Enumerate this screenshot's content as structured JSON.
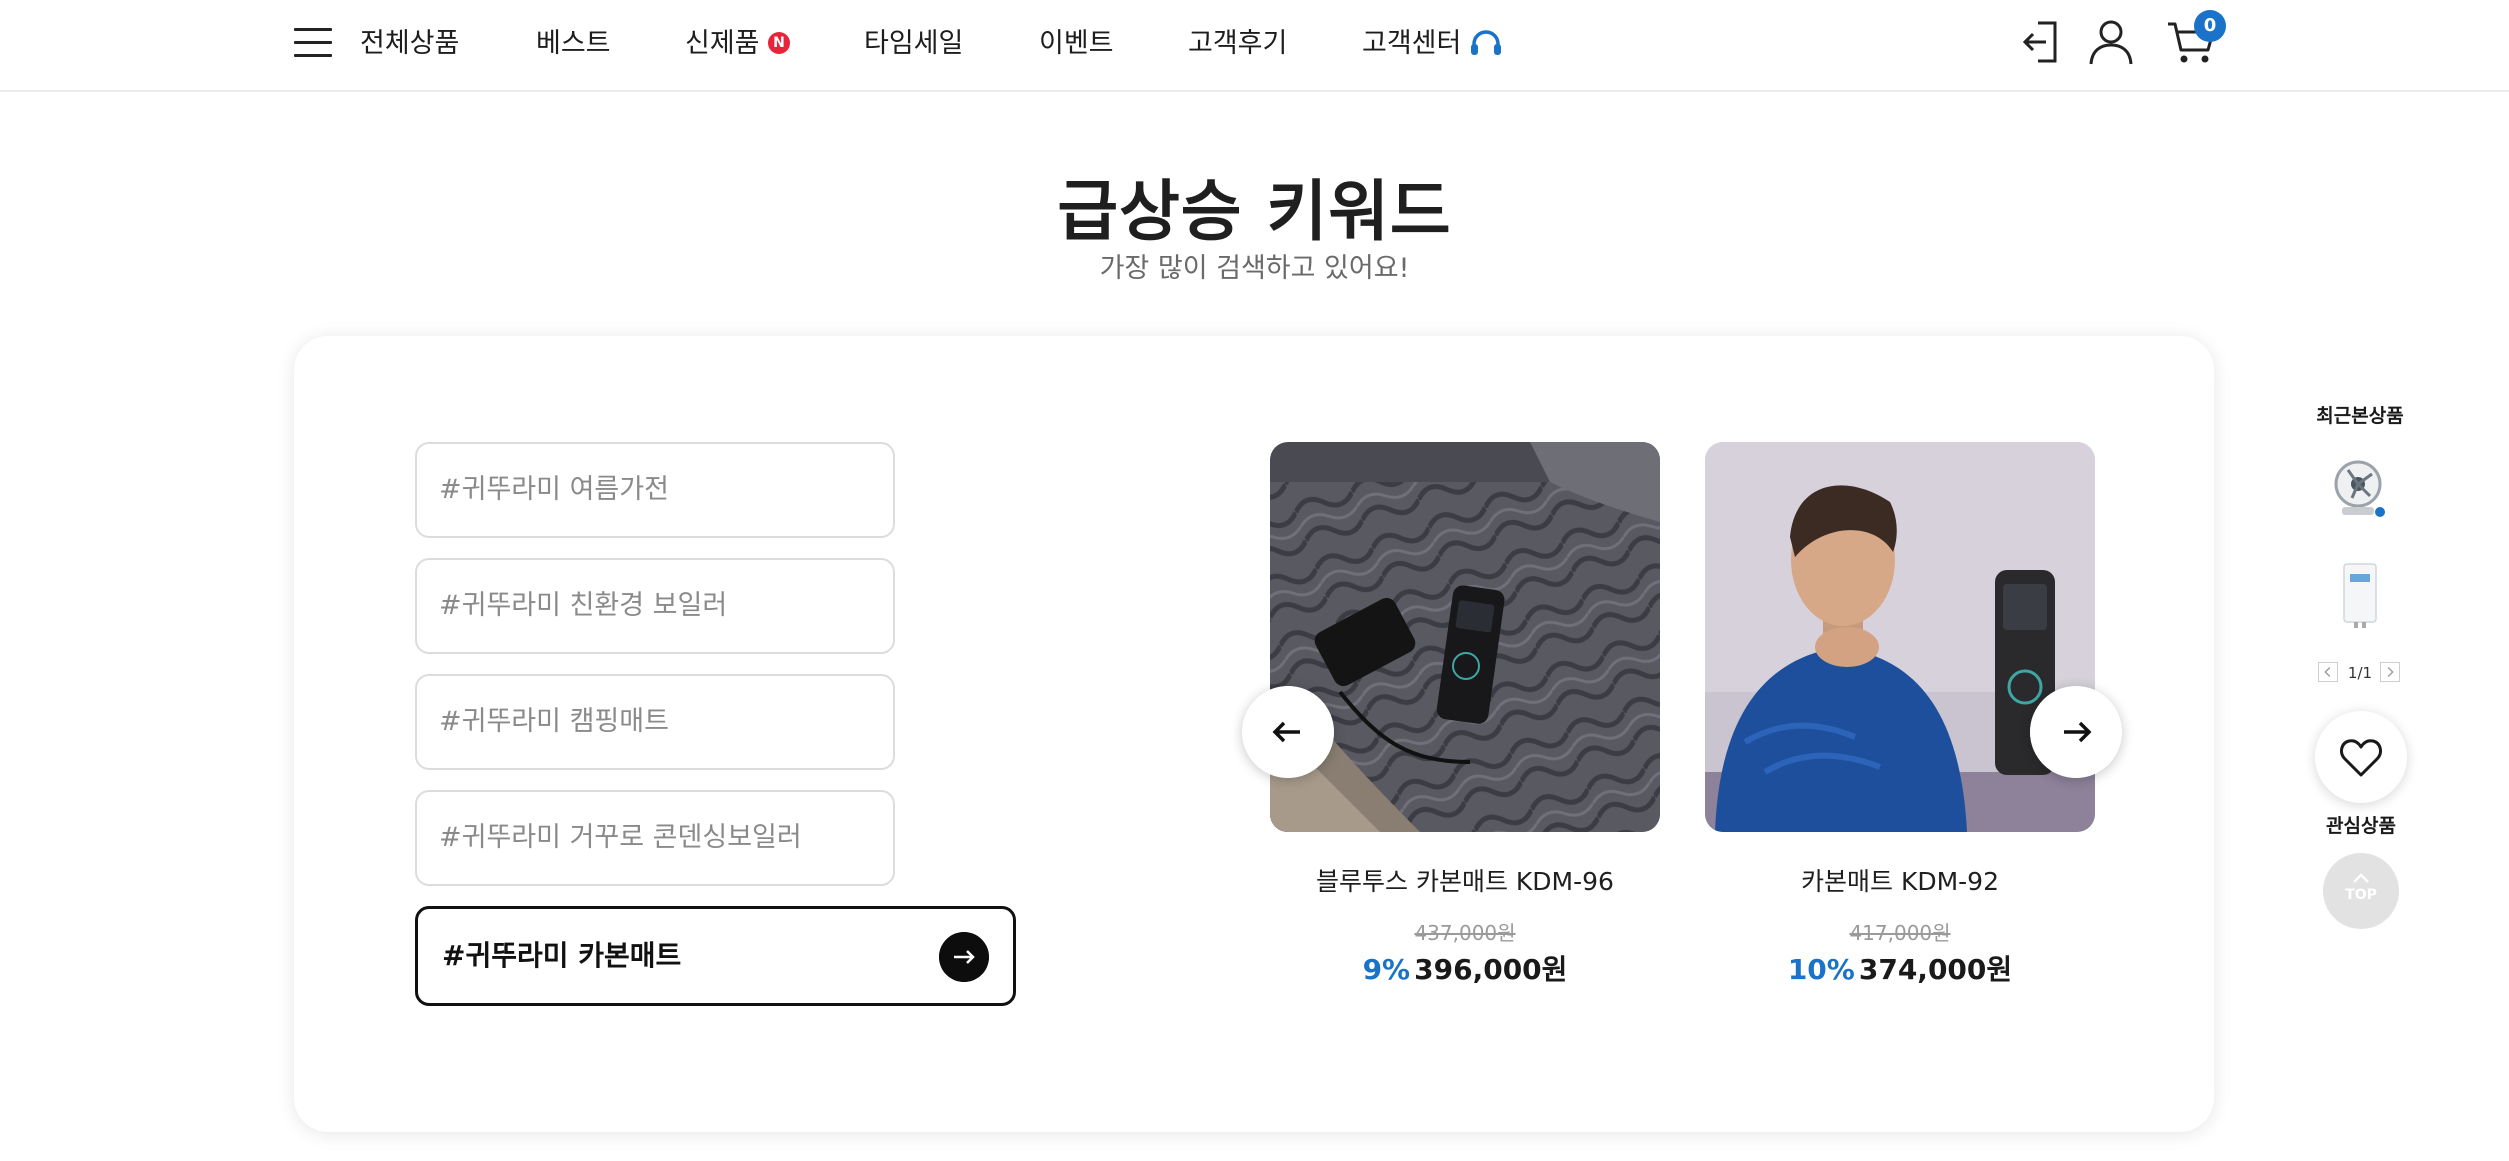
{
  "header": {
    "nav": [
      {
        "label": "전체상품"
      },
      {
        "label": "베스트"
      },
      {
        "label": "신제품",
        "badge": "N"
      },
      {
        "label": "타임세일"
      },
      {
        "label": "이벤트"
      },
      {
        "label": "고객후기"
      },
      {
        "label": "고객센터",
        "icon": "headset-icon"
      }
    ],
    "icons": [
      "menu-icon",
      "login-icon",
      "user-icon",
      "cart-icon"
    ],
    "cart_count": "0"
  },
  "section": {
    "title": "급상승 키워드",
    "subtitle": "가장 많이 검색하고 있어요!"
  },
  "keywords": [
    {
      "label": "#귀뚜라미 여름가전"
    },
    {
      "label": "#귀뚜라미 친환경 보일러"
    },
    {
      "label": "#귀뚜라미 캠핑매트"
    },
    {
      "label": "#귀뚜라미 거꾸로 콘덴싱보일러"
    },
    {
      "label": "#귀뚜라미 카본매트",
      "active": true
    }
  ],
  "products": [
    {
      "name": "블루투스 카본매트 KDM-96",
      "original_price": "437,000원",
      "discount": "9%",
      "price": "396,000원",
      "image": "carbon-mat-with-remote-photo"
    },
    {
      "name": "카본매트 KDM-92",
      "original_price": "417,000원",
      "discount": "10%",
      "price": "374,000원",
      "image": "man-in-blue-sweater-with-remote-photo"
    }
  ],
  "quickbar": {
    "recent_title": "최근본상품",
    "pager": "1/1",
    "wish_label": "관심상품",
    "top_label": "TOP"
  },
  "colors": {
    "accent_blue": "#1a73c8",
    "new_badge_red": "#e8243a",
    "text_dark": "#1f1f1f"
  }
}
